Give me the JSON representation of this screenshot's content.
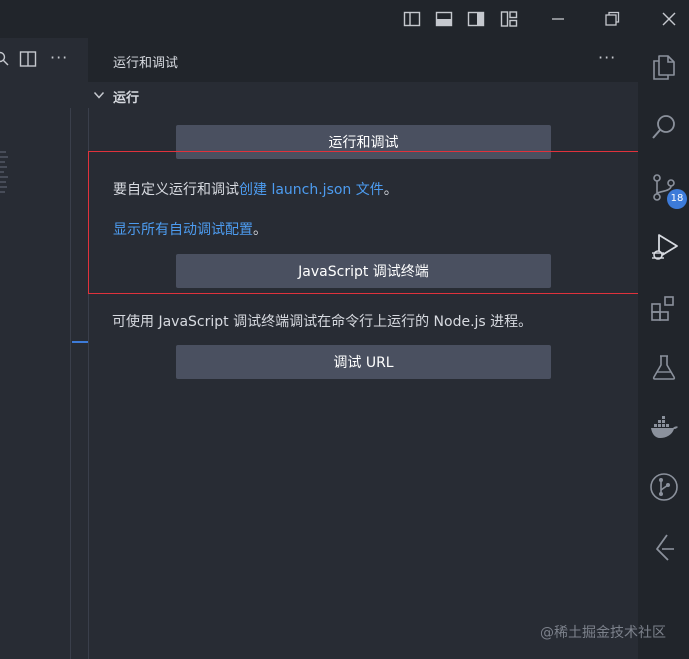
{
  "titlebar": {
    "icons": [
      "toggle-primary-sidebar-icon",
      "toggle-panel-icon",
      "toggle-secondary-sidebar-icon",
      "customize-layout-icon",
      "restore-window-icon",
      "close-window-icon"
    ]
  },
  "left_toolbar": {
    "more": "···"
  },
  "panel": {
    "title": "运行和调试",
    "more": "···",
    "section_title": "运行",
    "run_button": "运行和调试",
    "custom_text_prefix": "要自定义运行和调试",
    "custom_link": "创建 launch.json 文件",
    "custom_text_suffix": "。",
    "show_configs_link": "显示所有自动调试配置",
    "show_configs_suffix": "。",
    "js_terminal_button": "JavaScript 调试终端",
    "js_terminal_desc": "可使用 JavaScript 调试终端调试在命令行上运行的 Node.js 进程。",
    "debug_url_button": "调试 URL"
  },
  "activitybar": {
    "items": [
      "explorer-icon",
      "search-icon",
      "source-control-icon",
      "run-debug-icon",
      "extensions-icon",
      "testing-icon",
      "docker-icon",
      "git-graph-icon",
      "remote-explorer-icon"
    ],
    "scm_badge": "18"
  },
  "watermark": "@稀土掘金技术社区",
  "colors": {
    "accent": "#3d7bd9",
    "link": "#4d9cf0",
    "highlight": "#e0323c",
    "button": "#4a5060"
  }
}
